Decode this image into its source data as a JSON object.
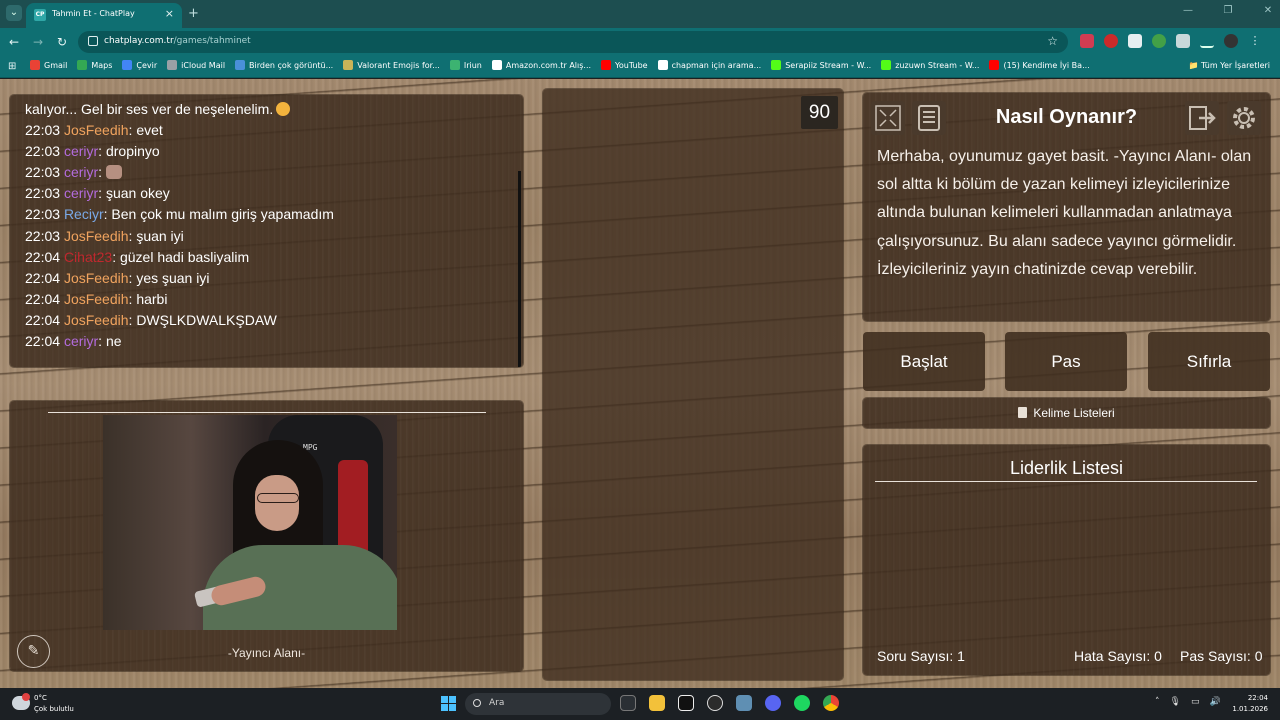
{
  "browser": {
    "tab_title": "Tahmin Et - ChatPlay",
    "tab_favicon_text": "CP",
    "url_domain": "chatplay.com.tr",
    "url_path": "/games/tahminet",
    "bookmarks": [
      {
        "label": "Gmail",
        "color": "#e94235"
      },
      {
        "label": "Maps",
        "color": "#34a853"
      },
      {
        "label": "Çevir",
        "color": "#4285f4"
      },
      {
        "label": "iCloud Mail",
        "color": "#9aa0a6"
      },
      {
        "label": "Birden çok görüntü...",
        "color": "#4a90d9"
      },
      {
        "label": "Valorant Emojis for...",
        "color": "#c9b458"
      },
      {
        "label": "Iriun",
        "color": "#3cb371"
      },
      {
        "label": "Amazon.com.tr Alış...",
        "color": "#ffffff"
      },
      {
        "label": "YouTube",
        "color": "#ff0000"
      },
      {
        "label": "chapman için arama...",
        "color": "#ffffff"
      },
      {
        "label": "Serapiiz Stream - W...",
        "color": "#53fc18"
      },
      {
        "label": "zuzuwn Stream - W...",
        "color": "#53fc18"
      },
      {
        "label": "(15) Kendime İyi Ba...",
        "color": "#ff0000"
      }
    ],
    "all_bookmarks_label": "Tüm Yer İşaretleri"
  },
  "chat": {
    "messages": [
      {
        "time": "",
        "user": "",
        "user_color": "#ffffff",
        "text": "kalıyor... Gel bir ses ver de neşelenelim.",
        "emoji": true,
        "image": false
      },
      {
        "time": "22:03",
        "user": "JosFeedih",
        "user_color": "#f0a35e",
        "text": "evet",
        "emoji": false,
        "image": false
      },
      {
        "time": "22:03",
        "user": "ceriyr",
        "user_color": "#b36bdc",
        "text": "dropinyo",
        "emoji": false,
        "image": false
      },
      {
        "time": "22:03",
        "user": "ceriyr",
        "user_color": "#b36bdc",
        "text": "",
        "emoji": false,
        "image": true
      },
      {
        "time": "22:03",
        "user": "ceriyr",
        "user_color": "#b36bdc",
        "text": "şuan okey",
        "emoji": false,
        "image": false
      },
      {
        "time": "22:03",
        "user": "Reciyr",
        "user_color": "#79a8e6",
        "text": "Ben çok mu malım giriş yapamadım",
        "emoji": false,
        "image": false
      },
      {
        "time": "22:03",
        "user": "JosFeedih",
        "user_color": "#f0a35e",
        "text": "şuan iyi",
        "emoji": false,
        "image": false
      },
      {
        "time": "22:04",
        "user": "Cihat23",
        "user_color": "#c0282e",
        "text": "güzel hadi basliyalim",
        "emoji": false,
        "image": false
      },
      {
        "time": "22:04",
        "user": "JosFeedih",
        "user_color": "#f0a35e",
        "text": "yes şuan iyi",
        "emoji": false,
        "image": false
      },
      {
        "time": "22:04",
        "user": "JosFeedih",
        "user_color": "#f0a35e",
        "text": "harbi",
        "emoji": false,
        "image": false
      },
      {
        "time": "22:04",
        "user": "JosFeedih",
        "user_color": "#f0a35e",
        "text": "DWŞLKDWALKŞDAW",
        "emoji": false,
        "image": false
      },
      {
        "time": "22:04",
        "user": "ceriyr",
        "user_color": "#b36bdc",
        "text": "ne",
        "emoji": false,
        "image": false
      }
    ]
  },
  "streamer": {
    "label": "-Yayıncı Alanı-",
    "chair_brand": "MPG"
  },
  "board": {
    "timer": "90"
  },
  "howto": {
    "title": "Nasıl Oynanır?",
    "text": "Merhaba, oyunumuz gayet basit. -Yayıncı Alanı- olan sol altta ki bölüm de yazan kelimeyi izleyicilerinize altında bulunan kelimeleri kullanmadan anlatmaya çalışıyorsunuz. Bu alanı sadece yayıncı görmelidir. İzleyicileriniz yayın chatinizde cevap verebilir."
  },
  "controls": {
    "start_label": "Başlat",
    "pass_label": "Pas",
    "reset_label": "Sıfırla",
    "word_lists_label": "Kelime Listeleri"
  },
  "leaderboard": {
    "title": "Liderlik Listesi",
    "question_count": "Soru Sayısı: 1",
    "error_count": "Hata Sayısı: 0",
    "pass_count": "Pas Sayısı: 0"
  },
  "taskbar": {
    "temperature": "0°C",
    "weather": "Çok bulutlu",
    "search_label": "Ara",
    "time": "22:04",
    "date": "1.01.2026"
  }
}
